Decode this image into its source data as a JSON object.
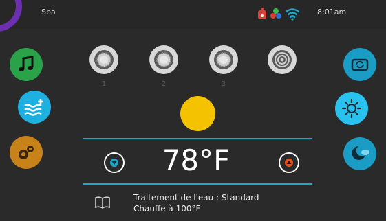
{
  "header": {
    "title": "Spa",
    "time": "8:01am",
    "status_icons": [
      "red-pump-icon",
      "color-lights-icon",
      "wifi-icon"
    ]
  },
  "left_menu": [
    {
      "name": "music-button",
      "icon": "music-note-icon",
      "color": "#2aa24a"
    },
    {
      "name": "water-care-button",
      "icon": "water-heat-plus-icon",
      "color": "#1eb0e0"
    },
    {
      "name": "settings-button",
      "icon": "gears-icon",
      "color": "#c8821a"
    }
  ],
  "right_menu": [
    {
      "name": "camera-button",
      "icon": "rotate-camera-icon",
      "color": "#1b9cc4"
    },
    {
      "name": "lights-button",
      "icon": "sun-icon",
      "color": "#29c2ee"
    },
    {
      "name": "night-mode-button",
      "icon": "moon-cloud-icon",
      "color": "#1b9cc4"
    }
  ],
  "lights": {
    "labels": [
      "1",
      "2",
      "3",
      ""
    ],
    "main_light_color": "#f5c200"
  },
  "temperature": {
    "value": "78°F",
    "accent": "#1fa8c9",
    "up_color": "#e8511c",
    "down_color": "#1fa8c9"
  },
  "info": {
    "water_treatment": "Traitement de l'eau : Standard",
    "heating": "Chauffe à 100°F"
  }
}
